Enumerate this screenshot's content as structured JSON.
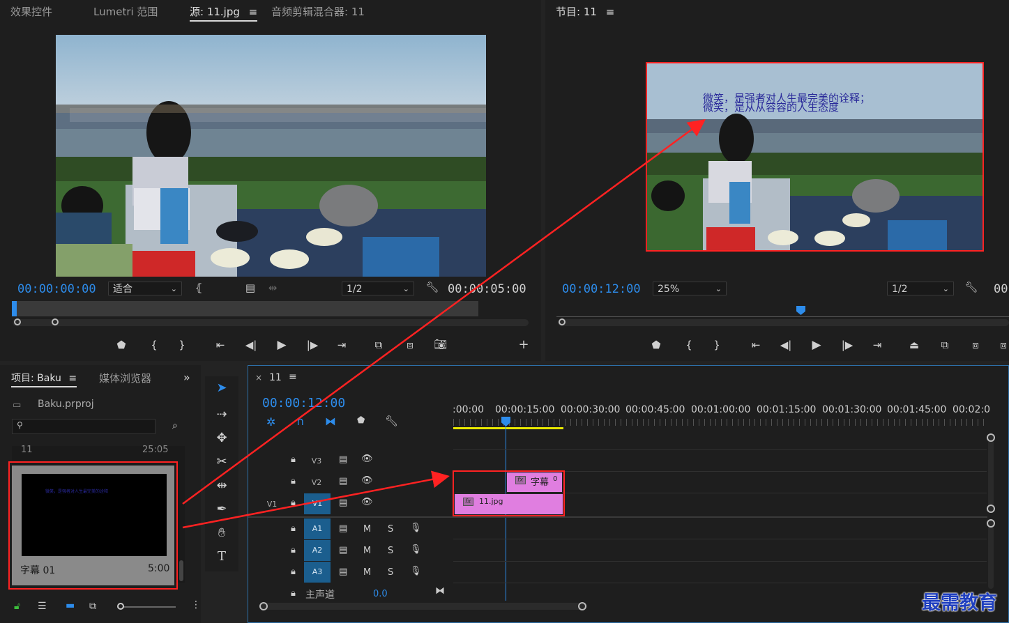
{
  "source_panel": {
    "tabs": [
      "效果控件",
      "Lumetri 范围",
      "源: 11.jpg",
      "音频剪辑混合器: 11"
    ],
    "active_tab_index": 2,
    "menu_icon": "≡",
    "timecode_left": "00:00:00:00",
    "fit_value": "适合",
    "resolution": "1/2",
    "timecode_right": "00:00:05:00"
  },
  "program_panel": {
    "title": "节目: 11",
    "menu_icon": "≡",
    "timecode": "00:00:12:00",
    "zoom": "25%",
    "resolution": "1/2",
    "timecode_right_partial": "00",
    "title_text_line1": "微笑，是强者对人生最完美的诠释；",
    "title_text_line2": "微笑，是从从容容的人生态度"
  },
  "project_panel": {
    "tab_project": "项目: Baku",
    "tab_media": "媒体浏览器",
    "file_name": "Baku.prproj",
    "search_placeholder": "",
    "item_above_name": "11",
    "item_above_duration": "25:05",
    "item_name": "字幕 01",
    "item_duration": "5:00",
    "thumb_text": "微笑，是强者对人生最完美的诠释"
  },
  "timeline": {
    "sequence_name": "11",
    "timecode": "00:00:12:00",
    "ruler_labels": [
      ":00:00",
      "00:00:15:00",
      "00:00:30:00",
      "00:00:45:00",
      "00:01:00:00",
      "00:01:15:00",
      "00:01:30:00",
      "00:01:45:00",
      "00:02:0"
    ],
    "video_tracks": [
      {
        "name": "V3",
        "source": ""
      },
      {
        "name": "V2",
        "source": ""
      },
      {
        "name": "V1",
        "source": "V1"
      }
    ],
    "audio_tracks": [
      {
        "name": "A1",
        "m": "M",
        "s": "S"
      },
      {
        "name": "A2",
        "m": "M",
        "s": "S"
      },
      {
        "name": "A3",
        "m": "M",
        "s": "S"
      }
    ],
    "master_label": "主声道",
    "master_value": "0.0",
    "clip_title": "字幕",
    "clip_title_suffix": "0",
    "clip_image": "11.jpg",
    "fx_badge": "fx"
  },
  "watermark": "最需教育",
  "colors": {
    "accent_blue": "#2d8ceb",
    "clip_pink": "#e07ee0",
    "highlight_red": "#ff2222",
    "track_blue": "#1b5e8e",
    "work_area_yellow": "#e8e800"
  }
}
